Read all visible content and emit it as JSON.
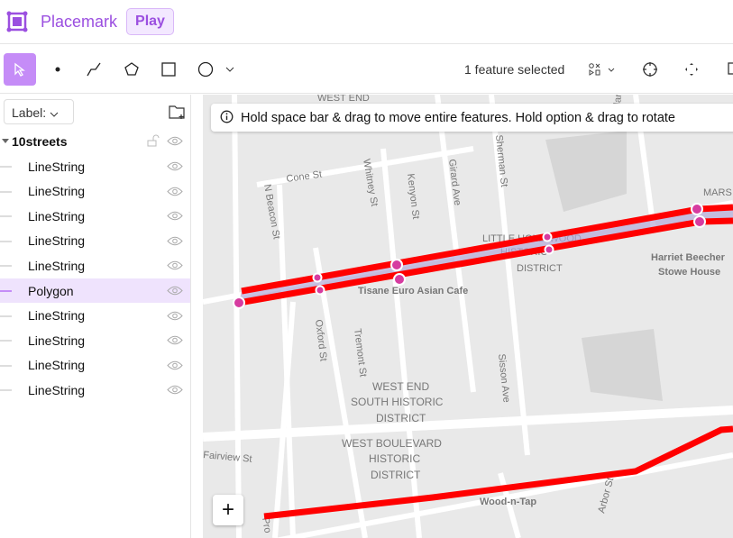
{
  "header": {
    "brand": "Placemark",
    "play_label": "Play"
  },
  "toolbar": {
    "selection_status": "1 feature selected"
  },
  "sidebar": {
    "label_button": "Label:",
    "layer": {
      "name": "10streets",
      "items": [
        {
          "label": "LineString",
          "selected": false
        },
        {
          "label": "LineString",
          "selected": false
        },
        {
          "label": "LineString",
          "selected": false
        },
        {
          "label": "LineString",
          "selected": false
        },
        {
          "label": "LineString",
          "selected": false
        },
        {
          "label": "Polygon",
          "selected": true
        },
        {
          "label": "LineString",
          "selected": false
        },
        {
          "label": "LineString",
          "selected": false
        },
        {
          "label": "LineString",
          "selected": false
        },
        {
          "label": "LineString",
          "selected": false
        }
      ]
    }
  },
  "map": {
    "hint": "Hold space bar & drag to move entire features. Hold option & drag to rotate",
    "zoom_in": "+",
    "labels": [
      "WEST END",
      "Cone St",
      "N Beacon St",
      "Whitney St",
      "Kenyon St",
      "Girard Ave",
      "Sherman St",
      "Woodland",
      "LITTLE HOLLYWOOD",
      "HISTORIC",
      "DISTRICT",
      "Harriet Beecher",
      "Stowe House",
      "MARS",
      "Tisane Euro Asian Cafe",
      "Oxford St",
      "Tremont St",
      "Sisson Ave",
      "WEST END",
      "SOUTH HISTORIC",
      "DISTRICT",
      "WEST BOULEVARD",
      "HISTORIC",
      "DISTRICT",
      "Wood-n-Tap",
      "Arbor St",
      "Fairview St",
      "Pro"
    ],
    "feature_color": "#ff0000",
    "vertex_color": "#d63ba0"
  }
}
